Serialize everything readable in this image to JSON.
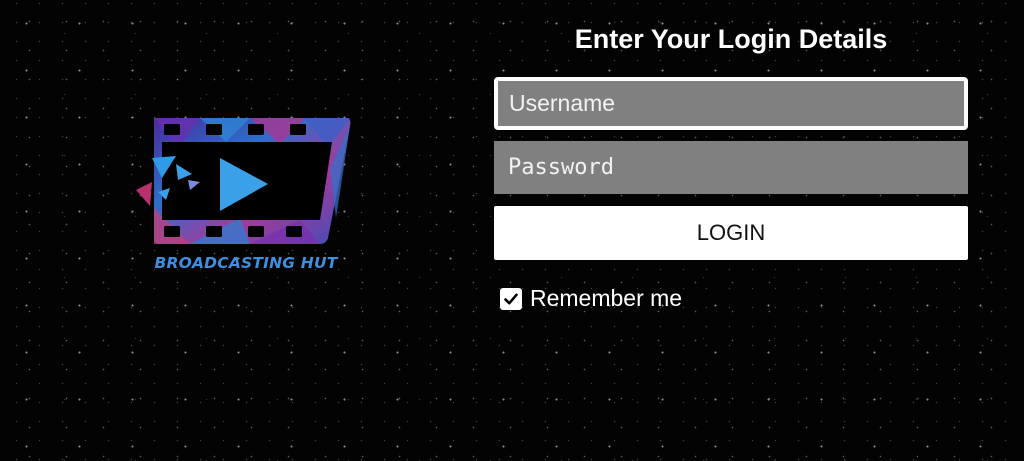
{
  "brand": {
    "logo_icon": "film-strip-play-icon",
    "name": "BROADCASTING HUT",
    "color": "#3f8fe0"
  },
  "login": {
    "heading": "Enter Your Login Details",
    "username_placeholder": "Username",
    "username_value": "",
    "password_placeholder": "Password",
    "password_value": "",
    "button_label": "LOGIN",
    "remember_label": "Remember me",
    "remember_checked": true
  },
  "colors": {
    "background": "#000000",
    "field_background": "#808080",
    "focus_border": "#ffffff",
    "button_background": "#ffffff"
  }
}
